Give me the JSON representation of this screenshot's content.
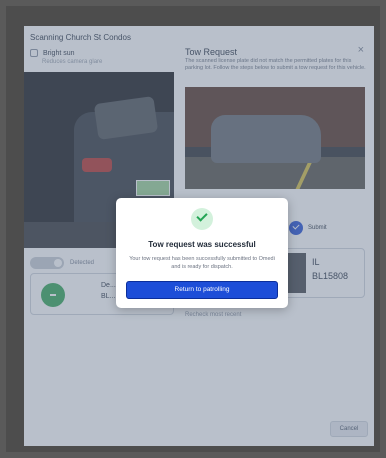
{
  "scan_panel": {
    "title": "Scanning Church St Condos",
    "bright_label": "Bright sun",
    "bright_sub": "Reduces camera glare",
    "tab_label": "Detected",
    "result_name": "De...",
    "result_plate": "BL..."
  },
  "tow_panel": {
    "title": "Tow Request",
    "close_glyph": "×",
    "description": "The scanned license plate did not match the permitted plates for this parking lot. Follow the steps below to submit a tow request for this vehicle.",
    "step_label": "Submit",
    "plate_state": "IL",
    "plate_number": "BL15808",
    "recheck_link": "Recheck most recent",
    "cancel_label": "Cancel"
  },
  "modal": {
    "title": "Tow request was successful",
    "message": "Your tow request has been successfully submitted to Omedi and is ready for dispatch.",
    "button_label": "Return to patrolling"
  },
  "colors": {
    "accent": "#1d4ed8",
    "success": "#23a455",
    "success_bg": "#d3f1dc",
    "overlay": "#64748b"
  }
}
